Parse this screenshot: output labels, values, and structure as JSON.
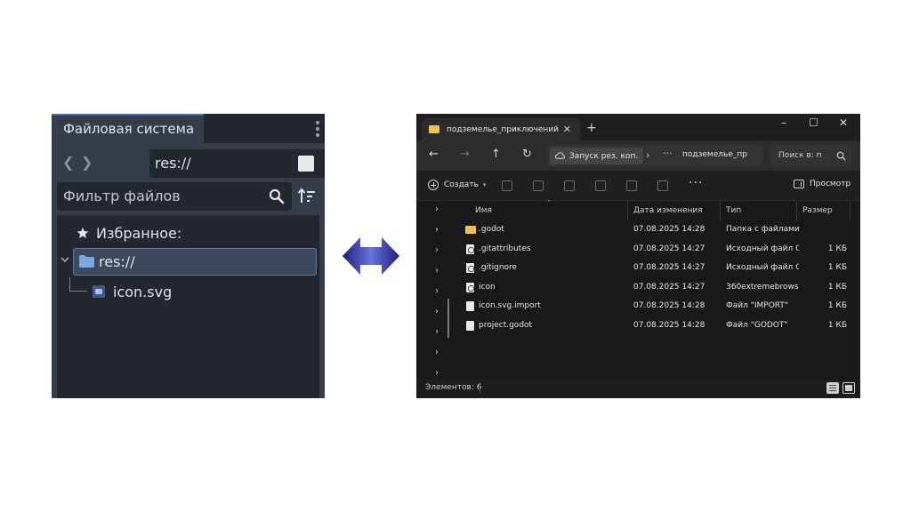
{
  "godot_dock": {
    "tab_title": "Файловая система",
    "path_value": "res://",
    "filter_placeholder": "Фильтр файлов",
    "favorites_label": "Избранное:",
    "root_label": "res://",
    "file_label": "icon.svg",
    "nav_back": "❮",
    "nav_forward": "❯"
  },
  "explorer": {
    "tab_title": "подземелье_приключений",
    "tab_close": "✕",
    "new_tab": "+",
    "window_controls": {
      "minimize": "–",
      "maximize": "☐",
      "close": "✕"
    },
    "nav": {
      "back": "←",
      "forward": "→",
      "up": "↑",
      "refresh": "↻"
    },
    "backup_label": "Запуск рез. коп.",
    "breadcrumb_sep": "›",
    "breadcrumb_more": "···",
    "breadcrumb_folder": "подземелье_пр",
    "search_placeholder": "Поиск в: п",
    "create_label": "Создать",
    "more_label": "···",
    "preview_label": "Просмотр",
    "columns": {
      "name": "Имя",
      "date": "Дата изменения",
      "type": "Тип",
      "size": "Размер"
    },
    "files": [
      {
        "name": ".godot",
        "date": "07.08.2025 14:28",
        "type": "Папка с файлами",
        "size": "",
        "icon": "folder-icon"
      },
      {
        "name": ".gitattributes",
        "date": "07.08.2025 14:27",
        "type": "Исходный файл G...",
        "size": "1 КБ",
        "icon": "git-file-icon"
      },
      {
        "name": ".gitignore",
        "date": "07.08.2025 14:27",
        "type": "Исходный файл G...",
        "size": "1 КБ",
        "icon": "git-file-icon"
      },
      {
        "name": "icon",
        "date": "07.08.2025 14:27",
        "type": "360extremebrows...",
        "size": "1 КБ",
        "icon": "svg-file-icon"
      },
      {
        "name": "icon.svg.import",
        "date": "07.08.2025 14:28",
        "type": "Файл \"IMPORT\"",
        "size": "1 КБ",
        "icon": "file-icon"
      },
      {
        "name": "project.godot",
        "date": "07.08.2025 14:28",
        "type": "Файл \"GODOT\"",
        "size": "1 КБ",
        "icon": "file-icon"
      }
    ],
    "status_text": "Элементов: 6"
  },
  "colors": {
    "godot_panel": "#363d4a",
    "godot_field": "#232830",
    "godot_selection": "#3d4a5e",
    "explorer_bg": "#191919",
    "folder_yellow": "#f3c14c",
    "arrow_navy": "#1a1f7a"
  }
}
